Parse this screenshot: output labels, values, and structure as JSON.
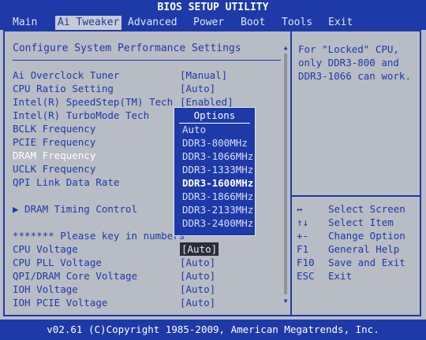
{
  "title": "BIOS SETUP UTILITY",
  "menu": [
    "Main",
    "Ai Tweaker",
    "Advanced",
    "Power",
    "Boot",
    "Tools",
    "Exit"
  ],
  "active_menu": "Ai Tweaker",
  "section_title": "Configure System Performance Settings",
  "settings": [
    {
      "label": "Ai Overclock Tuner",
      "value": "[Manual]"
    },
    {
      "label": "CPU Ratio Setting",
      "value": "[Auto]"
    },
    {
      "label": "Intel(R) SpeedStep(TM) Tech",
      "value": "[Enabled]"
    },
    {
      "label": "Intel(R) TurboMode Tech",
      "value": ""
    },
    {
      "label": "BCLK Frequency",
      "value": ""
    },
    {
      "label": "PCIE Frequency",
      "value": ""
    },
    {
      "label": "DRAM Frequency",
      "value": ""
    },
    {
      "label": "UCLK Frequency",
      "value": ""
    },
    {
      "label": "QPI Link Data Rate",
      "value": ""
    },
    {
      "label": "▶ DRAM Timing Control",
      "value": ""
    },
    {
      "label": "******* Please key in numbers",
      "value": ""
    },
    {
      "label": "CPU Voltage",
      "value": "[Auto]"
    },
    {
      "label": "CPU PLL Voltage",
      "value": "[Auto]"
    },
    {
      "label": "QPI/DRAM Core Voltage",
      "value": "[Auto]"
    },
    {
      "label": "IOH Voltage",
      "value": "[Auto]"
    },
    {
      "label": "IOH PCIE Voltage",
      "value": "[Auto]"
    }
  ],
  "help_text": "For \"Locked\" CPU, only DDR3-800 and DDR3-1066 can work.",
  "help_lines": [
    "For \"Locked\" CPU,",
    "only DDR3-800 and",
    "DDR3-1066 can work."
  ],
  "keys": [
    {
      "key": "↔",
      "desc": "Select Screen"
    },
    {
      "key": "↑↓",
      "desc": "Select Item"
    },
    {
      "key": "+-",
      "desc": "Change Option"
    },
    {
      "key": "F1",
      "desc": "General Help"
    },
    {
      "key": "F10",
      "desc": "Save and Exit"
    },
    {
      "key": "ESC",
      "desc": "Exit"
    }
  ],
  "popup": {
    "title": "Options",
    "options": [
      "Auto",
      "DDR3-800MHz",
      "DDR3-1066MHz",
      "DDR3-1333MHz",
      "DDR3-1600MHz",
      "DDR3-1866MHz",
      "DDR3-2133MHz",
      "DDR3-2400MHz"
    ],
    "selected": "DDR3-1600MHz"
  },
  "footer": "v02.61 (C)Copyright 1985-2009, American Megatrends, Inc.",
  "colors": {
    "accent": "#1e3aa8",
    "panel": "#b8bcc4",
    "highlight": "#ffffff"
  }
}
